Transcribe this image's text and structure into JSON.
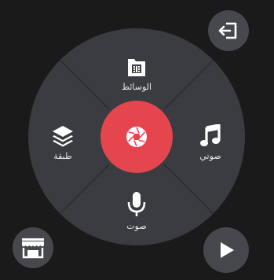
{
  "menu": {
    "top_label": "الوسائط",
    "left_label": "طبقة",
    "right_label": "صوتي",
    "bottom_label": "صوت"
  },
  "icons": {
    "top": "media-icon",
    "left": "layers-icon",
    "right": "music-note-icon",
    "bottom": "microphone-icon",
    "center": "camera-shutter-icon",
    "top_right": "exit-icon",
    "bottom_left": "store-icon",
    "bottom_right": "play-icon"
  },
  "colors": {
    "background": "#1a1a1a",
    "wheel": "#3a3c41",
    "accent": "#e5464e",
    "icon": "#ffffff",
    "corner_button": "#46484d"
  }
}
